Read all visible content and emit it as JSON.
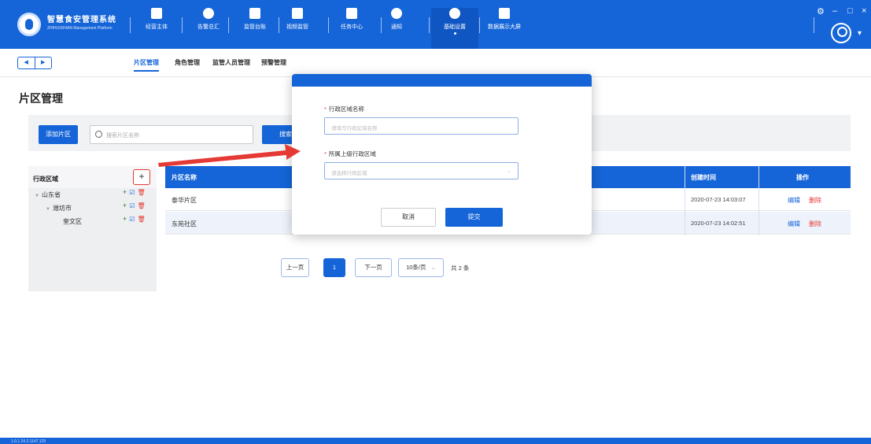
{
  "app": {
    "title_cn": "智慧食安管理系统",
    "title_en": "ZHIHUISHIAN Management Platform"
  },
  "nav": [
    {
      "label": "经营主体",
      "icon": "building-icon"
    },
    {
      "label": "告警总汇",
      "icon": "alarm-icon"
    },
    {
      "label": "监管台账",
      "icon": "ledger-icon"
    },
    {
      "label": "视频监管",
      "icon": "camera-icon"
    },
    {
      "label": "任务中心",
      "icon": "clipboard-icon"
    },
    {
      "label": "通知",
      "icon": "chat-icon"
    },
    {
      "label": "基础设置",
      "icon": "gear-icon",
      "active": true
    },
    {
      "label": "数据展示大屏",
      "icon": "screen-icon"
    }
  ],
  "window": {
    "settings": "⚙",
    "minimize": "–",
    "maximize": "□",
    "close": "×"
  },
  "subnav": {
    "tabs": [
      {
        "label": "片区管理",
        "active": true
      },
      {
        "label": "角色管理"
      },
      {
        "label": "监管人员管理"
      },
      {
        "label": "预警管理"
      }
    ],
    "prev": "◀",
    "next": "▶"
  },
  "page": {
    "title": "片区管理"
  },
  "toolbar": {
    "add_label": "添加片区",
    "search_placeholder": "搜索片区名称",
    "search_label": "搜索"
  },
  "tree": {
    "title": "行政区域",
    "add_symbol": "+",
    "nodes": [
      {
        "label": "山东省",
        "level": 0
      },
      {
        "label": "潍坊市",
        "level": 1
      },
      {
        "label": "奎文区",
        "level": 2
      }
    ],
    "action_add": "+",
    "action_edit": "☑",
    "action_delete": "🗑"
  },
  "table": {
    "headers": {
      "name": "片区名称",
      "created": "创建时间",
      "actions": "操作"
    },
    "rows": [
      {
        "name": "泰华片区",
        "created": "2020-07-23 14:03:07",
        "edit": "编辑",
        "delete": "删除"
      },
      {
        "name": "东苑社区",
        "created": "2020-07-23 14:02:51",
        "edit": "编辑",
        "delete": "删除"
      }
    ]
  },
  "pager": {
    "prev": "上一页",
    "current": "1",
    "next": "下一页",
    "page_size": "10条/页",
    "total": "共 2 条"
  },
  "modal": {
    "field1_label": "行政区域名称",
    "field1_placeholder": "请填写行政区域名称",
    "field2_label": "所属上级行政区域",
    "field2_placeholder": "请选择行政区域",
    "required_mark": "*",
    "cancel": "取消",
    "submit": "提交"
  },
  "footer": {
    "version": "1.0.1   24.2.1147.125"
  },
  "colors": {
    "primary": "#1565d8",
    "danger": "#e53935",
    "success": "#2e7d32",
    "annotation_arrow": "#e53935"
  }
}
